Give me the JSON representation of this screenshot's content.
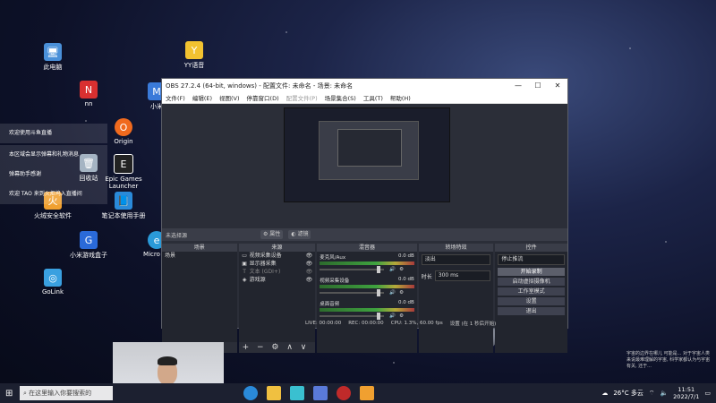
{
  "desktop": {
    "icons": [
      {
        "label": "此电脑",
        "icon": "computer-icon",
        "color": "#4a90d9"
      },
      {
        "label": "YY语音",
        "icon": "yy-icon",
        "color": "#f2c230"
      },
      {
        "label": "nn",
        "icon": "nn-icon",
        "color": "#d93030"
      },
      {
        "label": "小米",
        "icon": "xiaomi-icon",
        "color": "#3a7ad9"
      },
      {
        "label": "Origin",
        "icon": "origin-icon",
        "color": "#f06a1e"
      },
      {
        "label": "回收站",
        "icon": "recycle-bin-icon",
        "color": "#9ab"
      },
      {
        "label": "Epic Games Launcher",
        "icon": "epic-icon",
        "color": "#222"
      },
      {
        "label": "火绒安全软件",
        "icon": "huorong-icon",
        "color": "#f0a030"
      },
      {
        "label": "笔记本使用手册",
        "icon": "manual-icon",
        "color": "#2a8ad9"
      },
      {
        "label": "小米游戏盒子",
        "icon": "game-box-icon",
        "color": "#2a6ad9"
      },
      {
        "label": "GoLink",
        "icon": "golink-icon",
        "color": "#3aa0e0"
      },
      {
        "label": "Micro Ed",
        "icon": "edge-icon",
        "color": "#2a9ad9"
      }
    ],
    "notifications": [
      "欢迎使用斗鱼直播",
      "本区域会显示弹幕和礼物消息",
      "弹幕助手感谢",
      "欢迎 TAO 来到火炬坞入直播间"
    ],
    "watermark": "宇宙的边界在哪儿 可能是... 对于宇宙人类来说最难理解的宇宙, 科学家都认为与宇宙有关, 还于..."
  },
  "obs": {
    "title": "OBS 27.2.4 (64-bit, windows) - 配置文件: 未命名 - 场景: 未命名",
    "menu": [
      "文件(F)",
      "编辑(E)",
      "视图(V)",
      "停靠窗口(D)",
      "配置文件(P)",
      "场景集合(S)",
      "工具(T)",
      "帮助(H)"
    ],
    "menu_disabled_index": 4,
    "context_bar": {
      "no_source": "未选择源",
      "properties": "属性",
      "filters": "滤镜"
    },
    "docks": {
      "scenes": {
        "header": "场景",
        "items": [
          "场景"
        ],
        "footer": "+ − ∧ ∨"
      },
      "sources": {
        "header": "来源",
        "items": [
          {
            "icon": "monitor-icon",
            "label": "视频采集设备",
            "dim": false
          },
          {
            "icon": "display-icon",
            "label": "显示器采集",
            "dim": false
          },
          {
            "icon": "text-icon",
            "label": "文本 (GDI+)",
            "dim": true
          },
          {
            "icon": "gamepad-icon",
            "label": "游戏源",
            "dim": false
          }
        ],
        "footer": "+ − ⚙ ∧ ∨"
      },
      "mixer": {
        "header": "混音器",
        "channels": [
          {
            "name": "麦克风/Aux",
            "db": "0.0 dB"
          },
          {
            "name": "视频采集设备",
            "db": "0.0 dB"
          },
          {
            "name": "桌面音频",
            "db": "0.0 dB"
          }
        ]
      },
      "transitions": {
        "header": "转场特效",
        "type": "淡出",
        "duration_label": "时长",
        "duration": "300 ms"
      },
      "controls": {
        "header": "控件",
        "stream_select": "停止推流",
        "buttons": [
          "开始录制",
          "启动虚拟摄像机",
          "工作室模式",
          "设置",
          "退出"
        ],
        "active_index": 0
      }
    },
    "status": {
      "live": "LIVE: 00:00:00",
      "rec": "REC: 00:00:00",
      "cpu": "CPU: 1.3%, 60.00 fps",
      "state": "设置 (在 1 秒后开始)"
    }
  },
  "taskbar": {
    "search_placeholder": "在这里输入你要搜索的",
    "weather": "26°C 多云",
    "time": "11:51",
    "date": "2022/7/1"
  }
}
